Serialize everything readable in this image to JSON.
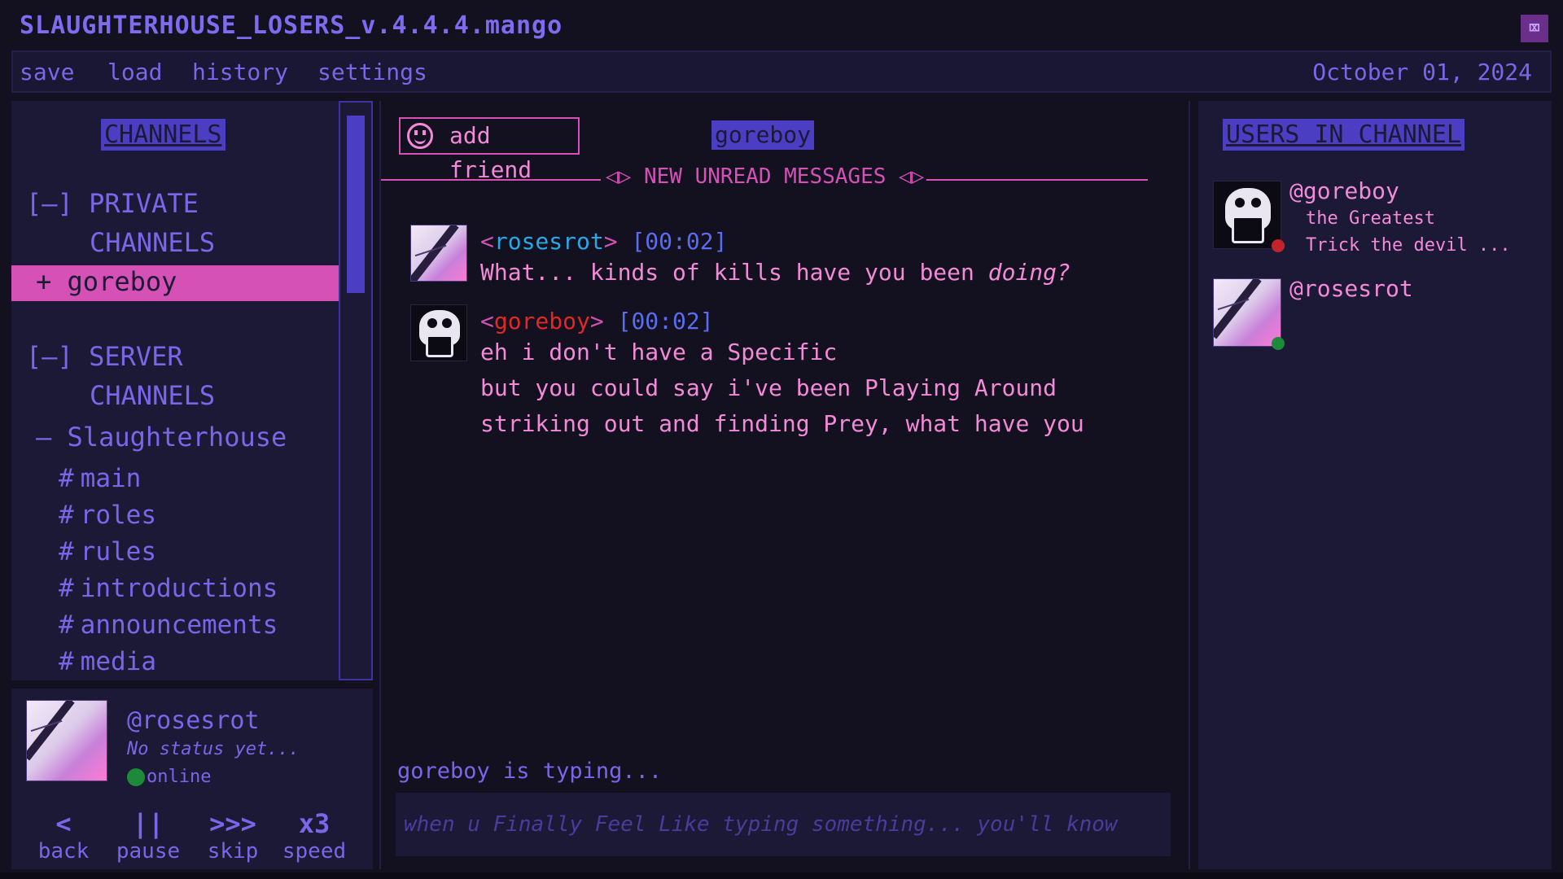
{
  "window": {
    "title": "SLAUGHTERHOUSE_LOSERS_v.4.4.4.mango",
    "close_glyph": "⌧"
  },
  "menu": {
    "items": [
      "save",
      "load",
      "history",
      "settings"
    ],
    "date": "October 01, 2024"
  },
  "sidebar": {
    "title": "CHANNELS",
    "private_head": {
      "l1": "[–] PRIVATE",
      "l2": "CHANNELS"
    },
    "private_items": [
      "+ goreboy"
    ],
    "server_head": {
      "l1": "[–] SERVER",
      "l2": "CHANNELS"
    },
    "server_name": "– Slaughterhouse",
    "channels": [
      "main",
      "roles",
      "rules",
      "introductions",
      "announcements",
      "media"
    ]
  },
  "user_card": {
    "name": "@rosesrot",
    "status": "No status yet...",
    "presence": "online",
    "controls": [
      {
        "symbol": "<",
        "label": "back"
      },
      {
        "symbol": "||",
        "label": "pause"
      },
      {
        "symbol": ">>>",
        "label": "skip"
      },
      {
        "symbol": "x3",
        "label": "speed"
      }
    ]
  },
  "chat": {
    "add_friend": "add friend",
    "tag": "goreboy",
    "divider": "◁▷ NEW UNREAD MESSAGES ◁▷",
    "messages": [
      {
        "user": "rosesrot",
        "time": "[00:02]",
        "user_color": "#29a8e8",
        "lines": [
          "What... kinds of kills have you been "
        ],
        "emphasis": "doing?"
      },
      {
        "user": "goreboy",
        "time": "[00:02]",
        "user_color": "#e32626",
        "lines": [
          "eh i don't have a Specific",
          "but you could say i've been Playing Around",
          "striking out and finding Prey, what have you"
        ]
      }
    ],
    "typing": "goreboy is typing...",
    "input_placeholder": "when u Finally Feel Like typing something... you'll know"
  },
  "users_panel": {
    "title": "USERS IN CHANNEL",
    "users": [
      {
        "name": "@goreboy",
        "sub1": "the Greatest",
        "sub2": "Trick the devil ...",
        "status_color": "#c2242e"
      },
      {
        "name": "@rosesrot",
        "status_color": "#1d8a3a"
      }
    ]
  },
  "colors": {
    "background": "#13111f",
    "panel": "#1b1935",
    "accent_purple": "#7a66e8",
    "accent_pink": "#d651b6",
    "text_pink": "#f38ad8",
    "time_blue": "#5a6cf0"
  }
}
